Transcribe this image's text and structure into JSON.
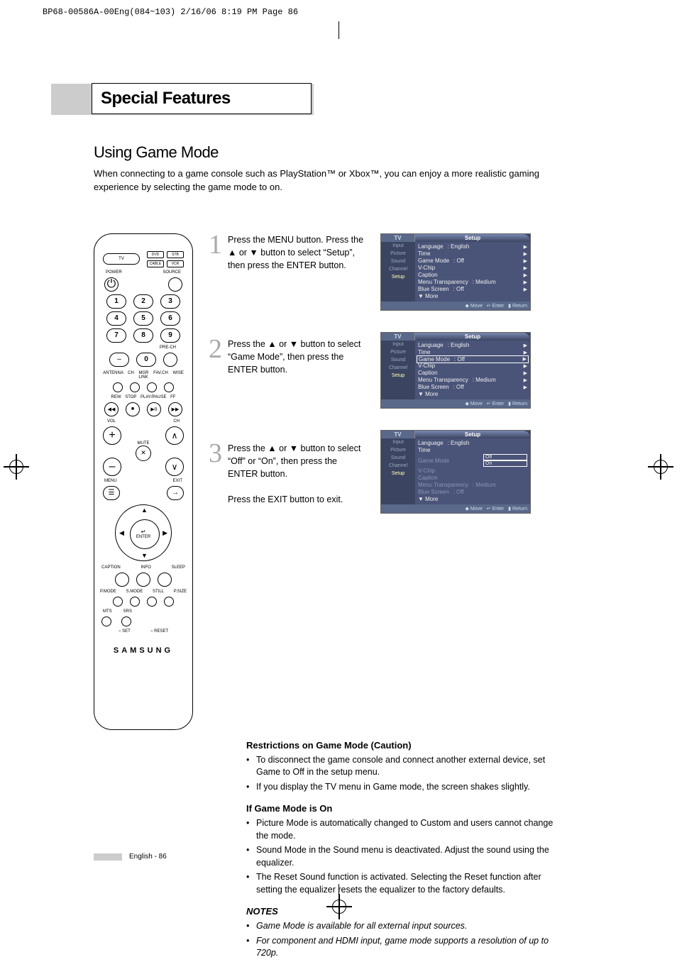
{
  "crop_mark": "BP68-00586A-00Eng(084~103)  2/16/06  8:19 PM  Page 86",
  "page_title": "Special Features",
  "section_heading": "Using Game Mode",
  "intro": "When connecting to a game console such as PlayStation™ or Xbox™, you can enjoy a more realistic gaming experience by selecting the game mode to on.",
  "remote": {
    "tv": "TV",
    "dvd": "DVD",
    "stb": "STB",
    "cable": "CABLE",
    "vcr": "VCR",
    "power": "POWER",
    "source": "SOURCE",
    "nums": [
      "1",
      "2",
      "3",
      "4",
      "5",
      "6",
      "7",
      "8",
      "9",
      "0"
    ],
    "dash": "–",
    "prech": "PRE-CH",
    "row_lbls": "ANTENNA  CH MGR  FAV.CH  WISE LINK",
    "trans_lbls": "REW   STOP   PLAY/PAUSE   FF",
    "vol": "VOL",
    "ch": "CH",
    "mute": "MUTE",
    "menu": "MENU",
    "exit": "EXIT",
    "enter": "ENTER",
    "caption": "CAPTION",
    "info": "INFO",
    "sleep": "SLEEP",
    "pmode": "P.MODE",
    "smode": "S.MODE",
    "still": "STILL",
    "psize": "P.SIZE",
    "mts": "MTS",
    "srs": "SRS",
    "set": "SET",
    "reset": "RESET",
    "brand": "SAMSUNG"
  },
  "steps": [
    {
      "num": "1",
      "text": "Press the MENU button. Press the ▲ or ▼ button to select “Setup”, then press the ENTER button."
    },
    {
      "num": "2",
      "text": "Press the ▲ or ▼ button to select “Game Mode”, then press the ENTER button."
    },
    {
      "num": "3",
      "text": "Press the ▲ or ▼ button to select “Off” or “On”, then press the ENTER button.",
      "tail": "Press the EXIT button to exit."
    }
  ],
  "osd_common": {
    "tv": "TV",
    "title": "Setup",
    "side": [
      "Input",
      "Picture",
      "Sound",
      "Channel",
      "Setup"
    ],
    "foot_move": "Move",
    "foot_enter": "Enter",
    "foot_return": "Return",
    "more": "▼ More"
  },
  "osd1": {
    "rows": [
      {
        "k": "Language",
        "v": ": English",
        "t": "▶"
      },
      {
        "k": "Time",
        "v": "",
        "t": "▶"
      },
      {
        "k": "Game Mode",
        "v": ": Off",
        "t": "▶"
      },
      {
        "k": "V-Chip",
        "v": "",
        "t": "▶"
      },
      {
        "k": "Caption",
        "v": "",
        "t": "▶"
      },
      {
        "k": "Menu Transparency",
        "v": ": Medium",
        "t": "▶"
      },
      {
        "k": "Blue Screen",
        "v": ": Off",
        "t": "▶"
      }
    ]
  },
  "osd2": {
    "rows": [
      {
        "k": "Language",
        "v": ": English",
        "t": "▶"
      },
      {
        "k": "Time",
        "v": "",
        "t": "▶"
      },
      {
        "k": "Game Mode",
        "v": ": Off",
        "t": "▶",
        "boxed": true
      },
      {
        "k": "V-Chip",
        "v": "",
        "t": "▶"
      },
      {
        "k": "Caption",
        "v": "",
        "t": "▶"
      },
      {
        "k": "Menu Transparency",
        "v": ": Medium",
        "t": "▶"
      },
      {
        "k": "Blue Screen",
        "v": ": Off",
        "t": "▶"
      }
    ]
  },
  "osd3": {
    "rows": [
      {
        "k": "Language",
        "v": ": English",
        "t": ""
      },
      {
        "k": "Time",
        "v": "",
        "t": ""
      },
      {
        "k": "Game Mode",
        "opts": [
          "Off",
          "On"
        ],
        "grey": true
      },
      {
        "k": "V-Chip",
        "v": "",
        "t": "",
        "grey": true
      },
      {
        "k": "Caption",
        "v": "",
        "t": "",
        "grey": true
      },
      {
        "k": "Menu Transparency",
        "v": ": Medium",
        "t": "",
        "grey": true
      },
      {
        "k": "Blue Screen",
        "v": ": Off",
        "t": "",
        "grey": true
      }
    ]
  },
  "sub1_h": "Restrictions on Game Mode (Caution)",
  "sub1": [
    "To disconnect the game console and connect another external device, set Game to Off in the setup menu.",
    "If you display the TV menu in Game mode, the screen shakes slightly."
  ],
  "sub2_h": "If Game Mode is On",
  "sub2": [
    "Picture Mode is automatically changed to Custom and users  cannot change the mode.",
    "Sound Mode in the Sound menu is deactivated. Adjust the sound using the equalizer.",
    "The Reset Sound function is activated. Selecting the Reset function after setting the equalizer resets the equalizer to the factory defaults."
  ],
  "notes_h": "NOTES",
  "notes": [
    "Game Mode is available for all external input sources.",
    "For component and HDMI input, game mode supports a resolution of up to 720p."
  ],
  "footer": "English - 86"
}
